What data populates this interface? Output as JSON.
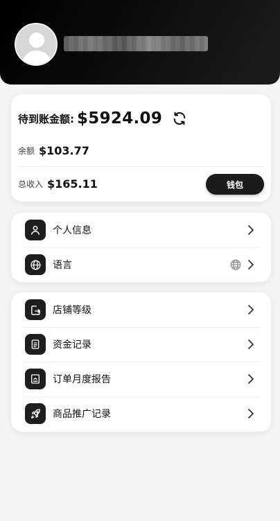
{
  "header": {
    "username": "■■■■■■■■■■■■■■■",
    "avatar_icon": "user-avatar-placeholder"
  },
  "balance": {
    "pending_label": "待到账金额:",
    "pending_value": "$5924.09",
    "refresh_icon": "refresh-icon",
    "available_label": "余额",
    "available_value": "$103.77",
    "total_income_label": "总收入",
    "total_income_value": "$165.11",
    "wallet_button_label": "钱包"
  },
  "menu_group_1": [
    {
      "label": "个人信息",
      "icon": "person-icon"
    },
    {
      "label": "语言",
      "icon": "globe-icon",
      "right_icon": "globe-icon"
    }
  ],
  "menu_group_2": [
    {
      "label": "店铺等级",
      "icon": "store-level-icon"
    },
    {
      "label": "资金记录",
      "icon": "document-icon"
    },
    {
      "label": "订单月度报告",
      "icon": "report-icon"
    },
    {
      "label": "商品推广记录",
      "icon": "rocket-icon"
    }
  ],
  "colors": {
    "header_bg": "#000000",
    "page_bg": "#f4f4f4",
    "card_bg": "#ffffff",
    "accent_dark": "#1c1c1c"
  }
}
